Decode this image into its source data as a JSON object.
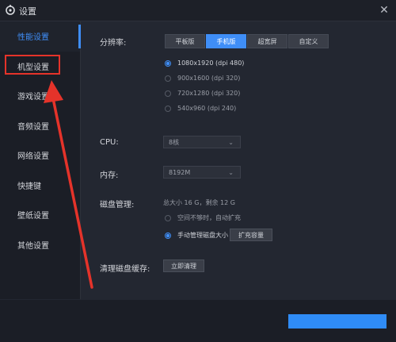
{
  "window": {
    "title": "设置",
    "close_symbol": "✕"
  },
  "sidebar": {
    "items": [
      {
        "label": "性能设置",
        "active": true
      },
      {
        "label": "机型设置",
        "active": false
      },
      {
        "label": "游戏设置",
        "active": false
      },
      {
        "label": "音频设置",
        "active": false
      },
      {
        "label": "网络设置",
        "active": false
      },
      {
        "label": "快捷键",
        "active": false
      },
      {
        "label": "壁纸设置",
        "active": false
      },
      {
        "label": "其他设置",
        "active": false
      }
    ]
  },
  "resolution": {
    "label": "分辨率:",
    "tabs": [
      "平板版",
      "手机版",
      "超宽屏",
      "自定义"
    ],
    "active_tab": "手机版",
    "options": [
      {
        "label": "1080x1920  (dpi 480)",
        "selected": true
      },
      {
        "label": "900x1600  (dpi 320)",
        "selected": false
      },
      {
        "label": "720x1280  (dpi 320)",
        "selected": false
      },
      {
        "label": "540x960  (dpi 240)",
        "selected": false
      }
    ]
  },
  "cpu": {
    "label": "CPU:",
    "value": "8核"
  },
  "memory": {
    "label": "内存:",
    "value": "8192M"
  },
  "disk": {
    "label": "磁盘管理:",
    "summary": "总大小 16 G，剩余 12 G",
    "options": [
      {
        "label": "空间不够时，自动扩充",
        "selected": false
      },
      {
        "label": "手动管理磁盘大小",
        "selected": true
      }
    ],
    "expand_button": "扩充容量"
  },
  "cache": {
    "label": "清理磁盘缓存:",
    "button": "立即清理"
  },
  "colors": {
    "accent": "#3f8ef7",
    "annotation": "#e5332a"
  }
}
